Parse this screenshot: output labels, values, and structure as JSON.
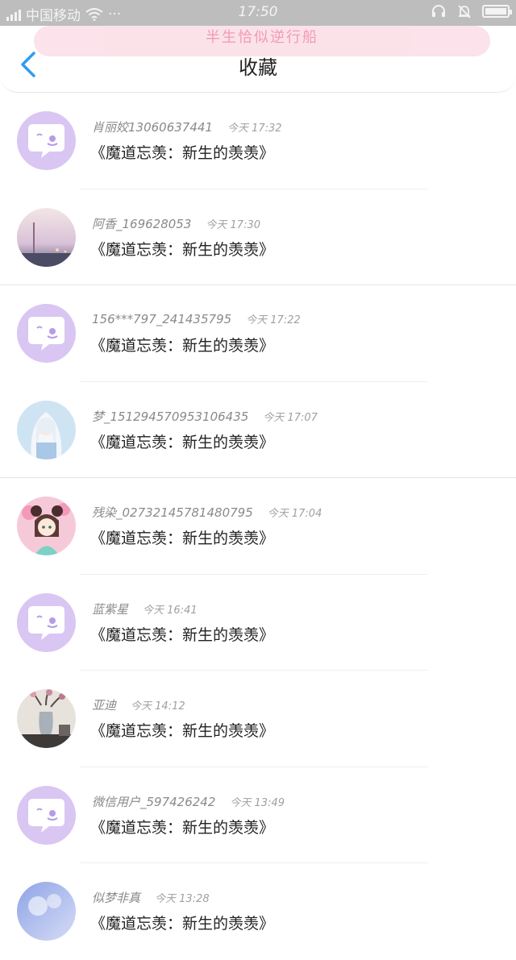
{
  "status_bar": {
    "carrier": "中国移动",
    "time": "17:50"
  },
  "header": {
    "banner": "半生恰似逆行船",
    "title": "收藏"
  },
  "items": [
    {
      "user": "肖丽姣13060637441",
      "time": "今天 17:32",
      "content": "《魔道忘羡：新生的羡羡》",
      "avatar": "default"
    },
    {
      "user": "阿香_169628053",
      "time": "今天 17:30",
      "content": "《魔道忘羡：新生的羡羡》",
      "avatar": "city"
    },
    {
      "user": "156***797_241435795",
      "time": "今天 17:22",
      "content": "《魔道忘羡：新生的羡羡》",
      "avatar": "default"
    },
    {
      "user": "梦_151294570953106435",
      "time": "今天 17:07",
      "content": "《魔道忘羡：新生的羡羡》",
      "avatar": "anime-white"
    },
    {
      "user": "残染_02732145781480795",
      "time": "今天 17:04",
      "content": "《魔道忘羡：新生的羡羡》",
      "avatar": "anime-pink"
    },
    {
      "user": "蓝紫星",
      "time": "今天 16:41",
      "content": "《魔道忘羡：新生的羡羡》",
      "avatar": "default"
    },
    {
      "user": "亚迪",
      "time": "今天 14:12",
      "content": "《魔道忘羡：新生的羡羡》",
      "avatar": "photo-vase"
    },
    {
      "user": "微信用户_597426242",
      "time": "今天 13:49",
      "content": "《魔道忘羡：新生的羡羡》",
      "avatar": "default"
    },
    {
      "user": "似梦非真",
      "time": "今天 13:28",
      "content": "《魔道忘羡：新生的羡羡》",
      "avatar": "sky"
    }
  ]
}
